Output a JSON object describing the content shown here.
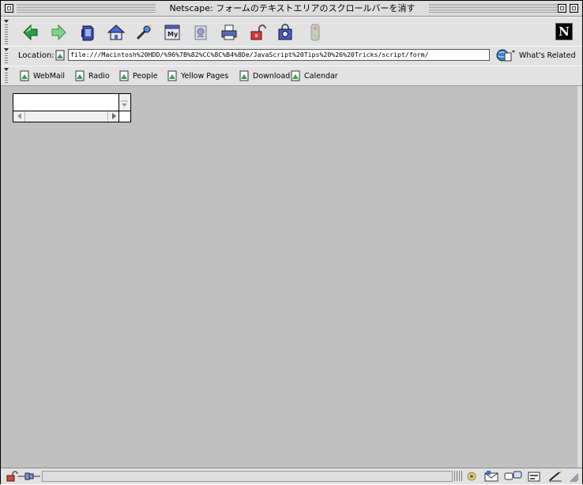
{
  "window": {
    "title": "Netscape: フォームのテキストエリアのスクロールバーを消す"
  },
  "navigation_toolbar": {
    "buttons": [
      {
        "name": "back-button",
        "icon": "back-arrow-icon",
        "color": "#2e9b4a"
      },
      {
        "name": "forward-button",
        "icon": "forward-arrow-icon",
        "color": "#6fcf7f"
      },
      {
        "name": "reload-button",
        "icon": "reload-icon",
        "color": "#3a4fb0"
      },
      {
        "name": "home-button",
        "icon": "home-icon",
        "color": "#4a6ad0"
      },
      {
        "name": "search-button",
        "icon": "search-icon",
        "color": "#3c7ae0"
      },
      {
        "name": "my-netscape-button",
        "icon": "my-netscape-icon",
        "color": "#5a5ad8"
      },
      {
        "name": "images-button",
        "icon": "images-icon",
        "color": "#8a8ad8"
      },
      {
        "name": "print-button",
        "icon": "print-icon",
        "color": "#5a6ab8"
      },
      {
        "name": "security-button",
        "icon": "security-lock-icon",
        "color": "#d83a3a"
      },
      {
        "name": "shop-button",
        "icon": "shop-icon",
        "color": "#4a5ac8"
      },
      {
        "name": "stop-button",
        "icon": "stop-icon",
        "color": "#b0b0b0"
      }
    ],
    "logo": "N"
  },
  "location_bar": {
    "label": "Location:",
    "url": "file:///Macintosh%20HDD/%96%7B%82%CC%8C%B4%8De/JavaScript%20Tips%20%26%20Tricks/script/form/",
    "related_label": "What's Related"
  },
  "personal_toolbar": {
    "items": [
      {
        "label": "WebMail"
      },
      {
        "label": "Radio"
      },
      {
        "label": "People"
      },
      {
        "label": "Yellow Pages"
      },
      {
        "label": "Download"
      },
      {
        "label": "Calendar"
      }
    ]
  },
  "colors": {
    "content_background": "#c0c0c0",
    "chrome": "#e2e2e2"
  }
}
